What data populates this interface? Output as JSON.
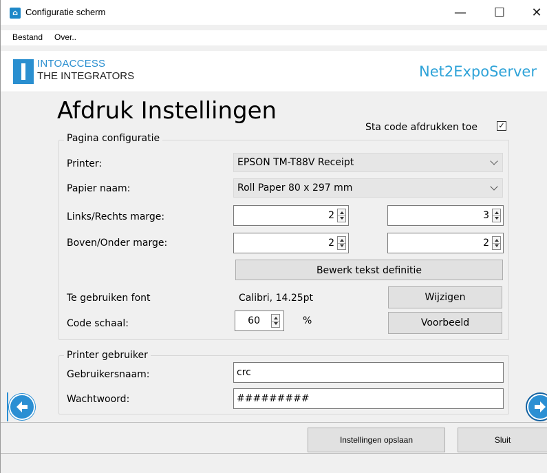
{
  "window": {
    "title": "Configuratie scherm",
    "controls": {
      "minimize": "—",
      "maximize": "☐",
      "close": "✕"
    }
  },
  "menu": {
    "items": [
      "Bestand",
      "Over.."
    ]
  },
  "header": {
    "logo_line1": "INTOACCESS",
    "logo_line2": "THE INTEGRATORS",
    "app_name": "Net2ExpoServer"
  },
  "page": {
    "title": "Afdruk Instellingen",
    "allow_code_label": "Sta code afdrukken toe",
    "allow_code_checked": "☑"
  },
  "page_config": {
    "legend": "Pagina configuratie",
    "printer_label": "Printer:",
    "printer_value": "EPSON TM-T88V Receipt",
    "paper_label": "Papier naam:",
    "paper_value": "Roll Paper 80 x 297 mm",
    "lr_margin_label": "Links/Rechts marge:",
    "left_margin": "2",
    "right_margin": "3",
    "tb_margin_label": "Boven/Onder marge:",
    "top_margin": "2",
    "bottom_margin": "2",
    "edit_text_button": "Bewerk tekst definitie",
    "font_label": "Te gebruiken font",
    "font_value": "Calibri, 14.25pt",
    "change_button": "Wijzigen",
    "scale_label": "Code schaal:",
    "scale_value": "60",
    "scale_unit": "%",
    "preview_button": "Voorbeeld"
  },
  "printer_user": {
    "legend": "Printer gebruiker",
    "username_label": "Gebruikersnaam:",
    "username_value": "crc",
    "password_label": "Wachtwoord:",
    "password_value": "#########"
  },
  "footer": {
    "save_button": "Instellingen opslaan",
    "close_button": "Sluit"
  },
  "colors": {
    "accent": "#2a8fd0",
    "app_name": "#2fa3d8",
    "window_bg": "#f0f0f0"
  },
  "icons": {
    "app_icon": "building-icon",
    "nav_left": "arrow-left-circle-icon",
    "nav_right": "arrow-right-circle-icon"
  }
}
